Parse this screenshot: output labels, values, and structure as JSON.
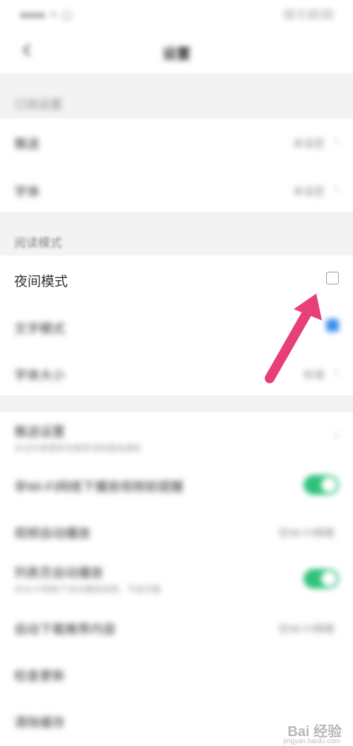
{
  "status_bar": {
    "left_text": "●●●● 〃 ▢",
    "right_text": "▯▯ ▯ ▯▯:▯▯"
  },
  "header": {
    "title": "设置"
  },
  "sections": {
    "general_header": "订阅设置",
    "reading_header": "阅读模式"
  },
  "general_rows": [
    {
      "label": "推送",
      "value": "未设定"
    },
    {
      "label": "字体",
      "value": "未设定"
    }
  ],
  "reading_rows": {
    "night_mode": {
      "label": "夜间模式",
      "checked": false
    },
    "text_mode": {
      "label": "文字模式",
      "checked": true
    },
    "font_size": {
      "label": "字体大小",
      "value": "标准"
    }
  },
  "other_rows": [
    {
      "label": "推送设置",
      "sub": "关注作者更新及推荐消息推送通知"
    },
    {
      "label": "非Wi-Fi网络下播放视频前提醒",
      "toggle": true
    },
    {
      "label": "视频自动播放",
      "value": "仅Wi-Fi网络"
    },
    {
      "label": "列表页自动播放",
      "sub": "在Wi-Fi网络下自动播放视频，节省流量",
      "toggle": true
    },
    {
      "label": "自动下载推荐内容",
      "value": "仅Wi-Fi网络"
    },
    {
      "label": "检查更新"
    },
    {
      "label": "清除缓存"
    }
  ],
  "watermark": {
    "brand": "Bai 经验",
    "url": "jingyan.baidu.com"
  },
  "colors": {
    "accent": "#3b8df0",
    "toggle_on": "#2fc27a",
    "arrow": "#e83e7a"
  }
}
